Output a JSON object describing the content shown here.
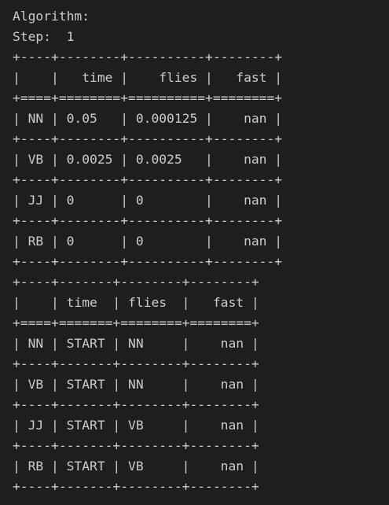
{
  "terminal": {
    "header": {
      "algorithm_label": "Algorithm:",
      "step_line": "Step:  1"
    },
    "tables": [
      {
        "lines": [
          "+----+--------+----------+--------+",
          "|    |   time |    flies |   fast |",
          "+====+========+==========+========+",
          "| NN | 0.05   | 0.000125 |    nan |",
          "+----+--------+----------+--------+",
          "| VB | 0.0025 | 0.0025   |    nan |",
          "+----+--------+----------+--------+",
          "| JJ | 0      | 0        |    nan |",
          "+----+--------+----------+--------+",
          "| RB | 0      | 0        |    nan |",
          "+----+--------+----------+--------+"
        ]
      },
      {
        "lines": [
          "+----+-------+--------+--------+",
          "|    | time  | flies  |   fast |",
          "+====+=======+========+========+",
          "| NN | START | NN     |    nan |",
          "+----+-------+--------+--------+",
          "| VB | START | NN     |    nan |",
          "+----+-------+--------+--------+",
          "| JJ | START | VB     |    nan |",
          "+----+-------+--------+--------+",
          "| RB | START | VB     |    nan |",
          "+----+-------+--------+--------+"
        ]
      }
    ]
  }
}
